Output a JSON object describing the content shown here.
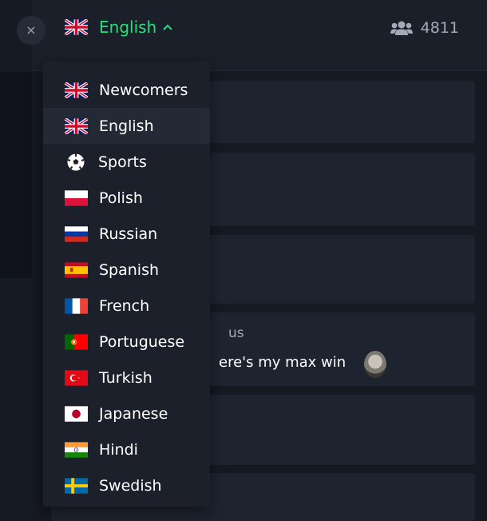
{
  "header": {
    "close_label": "×",
    "current_language": "English",
    "current_flag": "uk-flag-icon",
    "online_count": "4811",
    "accent_color": "#27e07c"
  },
  "messages": {
    "author_partial": "us",
    "text_partial": "ere's my max win"
  },
  "dropdown": {
    "items": [
      {
        "label": "Newcomers",
        "icon": "uk-flag-icon"
      },
      {
        "label": "English",
        "icon": "uk-flag-icon",
        "selected": true
      },
      {
        "label": "Sports",
        "icon": "soccer-ball-icon"
      },
      {
        "label": "Polish",
        "icon": "poland-flag-icon"
      },
      {
        "label": "Russian",
        "icon": "russia-flag-icon"
      },
      {
        "label": "Spanish",
        "icon": "spain-flag-icon"
      },
      {
        "label": "French",
        "icon": "france-flag-icon"
      },
      {
        "label": "Portuguese",
        "icon": "portugal-flag-icon"
      },
      {
        "label": "Turkish",
        "icon": "turkey-flag-icon"
      },
      {
        "label": "Japanese",
        "icon": "japan-flag-icon"
      },
      {
        "label": "Hindi",
        "icon": "india-flag-icon"
      },
      {
        "label": "Swedish",
        "icon": "sweden-flag-icon"
      }
    ]
  }
}
